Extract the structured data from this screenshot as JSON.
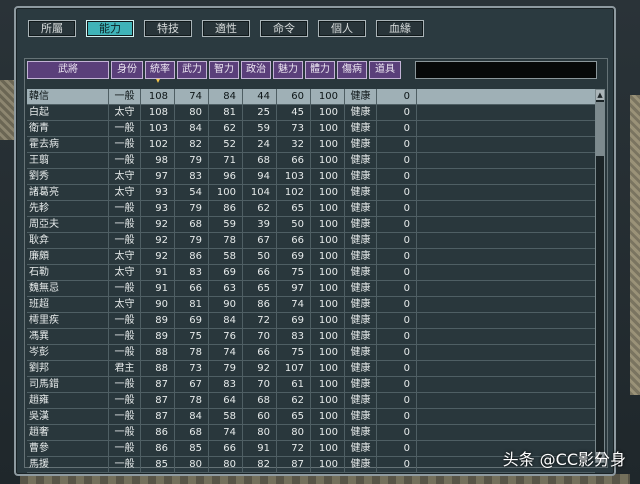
{
  "tabs": [
    "所屬",
    "能力",
    "特技",
    "適性",
    "命令",
    "個人",
    "血緣"
  ],
  "active_tab": 1,
  "headers": [
    "武將",
    "身份",
    "統率",
    "武力",
    "智力",
    "政治",
    "魅力",
    "體力",
    "傷病",
    "道具"
  ],
  "sort_mark": "▾",
  "rows": [
    [
      "韓信",
      "一般",
      "108",
      "74",
      "84",
      "44",
      "60",
      "100",
      "健康",
      "0"
    ],
    [
      "白起",
      "太守",
      "108",
      "80",
      "81",
      "25",
      "45",
      "100",
      "健康",
      "0"
    ],
    [
      "衛青",
      "一般",
      "103",
      "84",
      "62",
      "59",
      "73",
      "100",
      "健康",
      "0"
    ],
    [
      "霍去病",
      "一般",
      "102",
      "82",
      "52",
      "24",
      "32",
      "100",
      "健康",
      "0"
    ],
    [
      "王翦",
      "一般",
      "98",
      "79",
      "71",
      "68",
      "66",
      "100",
      "健康",
      "0"
    ],
    [
      "劉秀",
      "太守",
      "97",
      "83",
      "96",
      "94",
      "103",
      "100",
      "健康",
      "0"
    ],
    [
      "諸葛亮",
      "太守",
      "93",
      "54",
      "100",
      "104",
      "102",
      "100",
      "健康",
      "0"
    ],
    [
      "先軫",
      "一般",
      "93",
      "79",
      "86",
      "62",
      "65",
      "100",
      "健康",
      "0"
    ],
    [
      "周亞夫",
      "一般",
      "92",
      "68",
      "59",
      "39",
      "50",
      "100",
      "健康",
      "0"
    ],
    [
      "耿弇",
      "一般",
      "92",
      "79",
      "78",
      "67",
      "66",
      "100",
      "健康",
      "0"
    ],
    [
      "廉頗",
      "太守",
      "92",
      "86",
      "58",
      "50",
      "69",
      "100",
      "健康",
      "0"
    ],
    [
      "石勒",
      "太守",
      "91",
      "83",
      "69",
      "66",
      "75",
      "100",
      "健康",
      "0"
    ],
    [
      "魏無忌",
      "一般",
      "91",
      "66",
      "63",
      "65",
      "97",
      "100",
      "健康",
      "0"
    ],
    [
      "班超",
      "太守",
      "90",
      "81",
      "90",
      "86",
      "74",
      "100",
      "健康",
      "0"
    ],
    [
      "樗里疾",
      "一般",
      "89",
      "69",
      "84",
      "72",
      "69",
      "100",
      "健康",
      "0"
    ],
    [
      "馮異",
      "一般",
      "89",
      "75",
      "76",
      "70",
      "83",
      "100",
      "健康",
      "0"
    ],
    [
      "岑彭",
      "一般",
      "88",
      "78",
      "74",
      "66",
      "75",
      "100",
      "健康",
      "0"
    ],
    [
      "劉邦",
      "君主",
      "88",
      "73",
      "79",
      "92",
      "107",
      "100",
      "健康",
      "0"
    ],
    [
      "司馬錯",
      "一般",
      "87",
      "67",
      "83",
      "70",
      "61",
      "100",
      "健康",
      "0"
    ],
    [
      "趙雍",
      "一般",
      "87",
      "78",
      "64",
      "68",
      "62",
      "100",
      "健康",
      "0"
    ],
    [
      "吳漢",
      "一般",
      "87",
      "84",
      "58",
      "60",
      "65",
      "100",
      "健康",
      "0"
    ],
    [
      "趙奢",
      "一般",
      "86",
      "68",
      "74",
      "80",
      "80",
      "100",
      "健康",
      "0"
    ],
    [
      "曹參",
      "一般",
      "86",
      "85",
      "66",
      "91",
      "72",
      "100",
      "健康",
      "0"
    ],
    [
      "馬援",
      "一般",
      "85",
      "80",
      "80",
      "82",
      "87",
      "100",
      "健康",
      "0"
    ]
  ],
  "selected_row": 0,
  "scroll": {
    "up": "▲",
    "down": "▼"
  },
  "watermark": "头条 @CC影分身",
  "colors": {
    "tab_active": "#3fb3b8",
    "header": "#5a3f7a",
    "selected": "#9fb0b6"
  }
}
